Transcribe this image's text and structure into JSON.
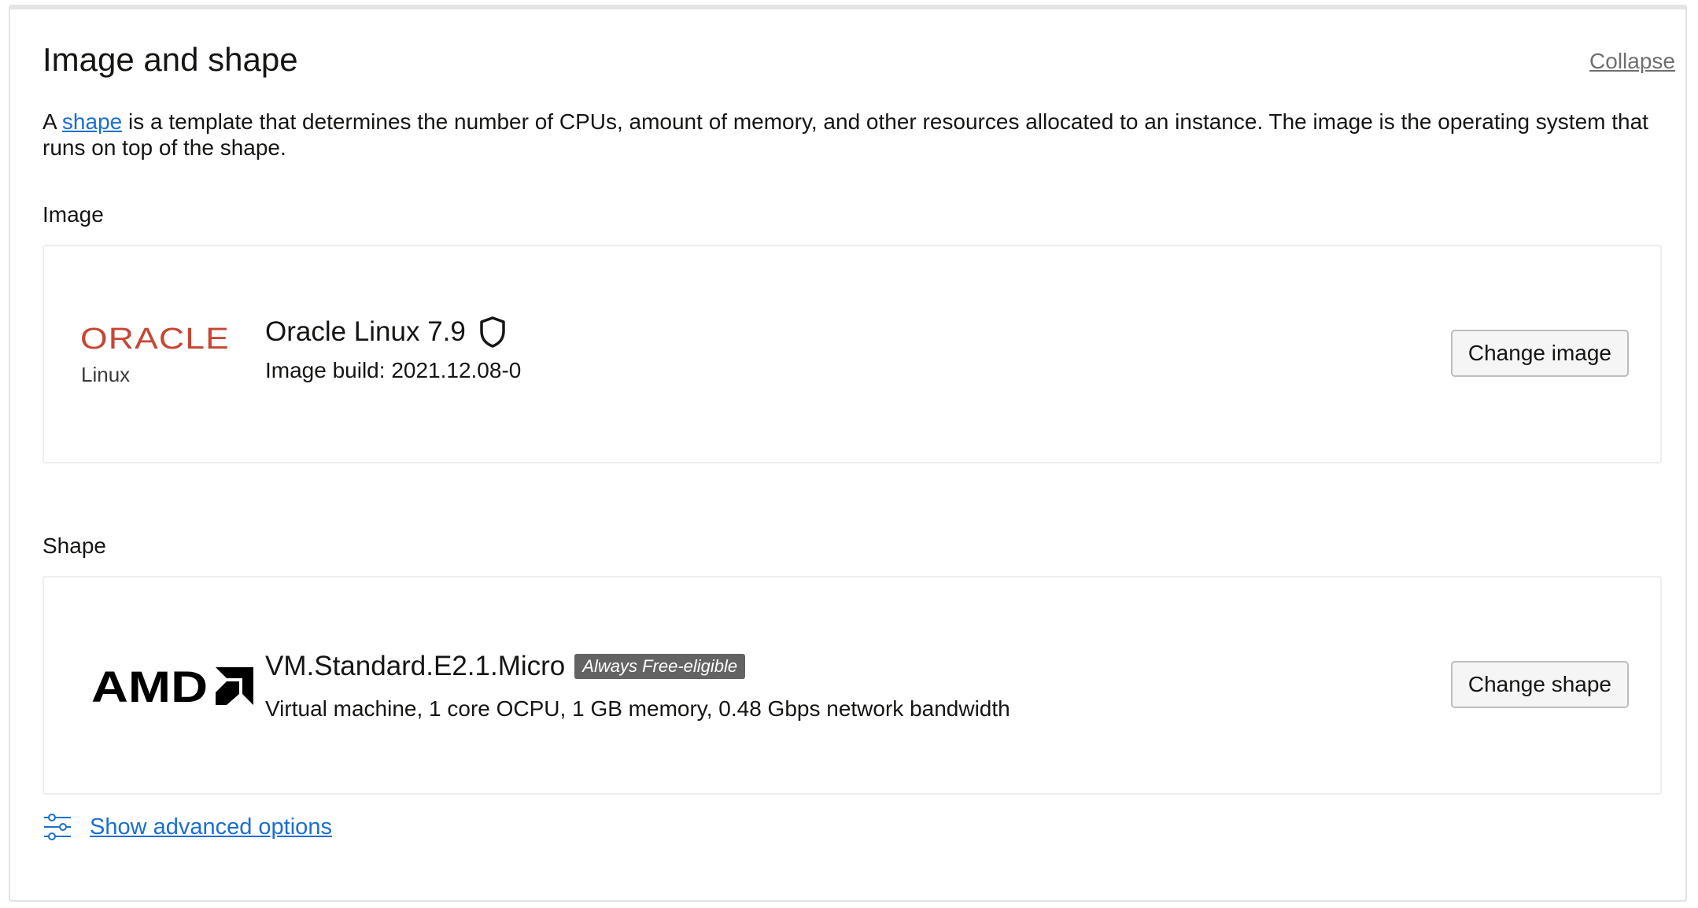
{
  "section": {
    "title": "Image and shape",
    "collapse_label": "Collapse",
    "description_prefix": "A ",
    "description_link": "shape",
    "description_rest": " is a template that determines the number of CPUs, amount of memory, and other resources allocated to an instance. The image is the operating system that runs on top of the shape."
  },
  "image": {
    "label": "Image",
    "logo_brand": "ORACLE",
    "logo_product": "Linux",
    "name": "Oracle Linux 7.9",
    "build": "Image build: 2021.12.08-0",
    "button_label": "Change image",
    "shield_icon": "shield-icon"
  },
  "shape": {
    "label": "Shape",
    "logo_brand": "AMD",
    "name": "VM.Standard.E2.1.Micro",
    "badge": "Always Free-eligible",
    "details": "Virtual machine, 1 core OCPU, 1 GB memory, 0.48 Gbps network bandwidth",
    "button_label": "Change shape"
  },
  "advanced": {
    "label": "Show advanced options",
    "icon": "sliders-icon"
  },
  "colors": {
    "link": "#1a6fd1",
    "oracle_red": "#c74634",
    "badge_bg": "#636363"
  }
}
